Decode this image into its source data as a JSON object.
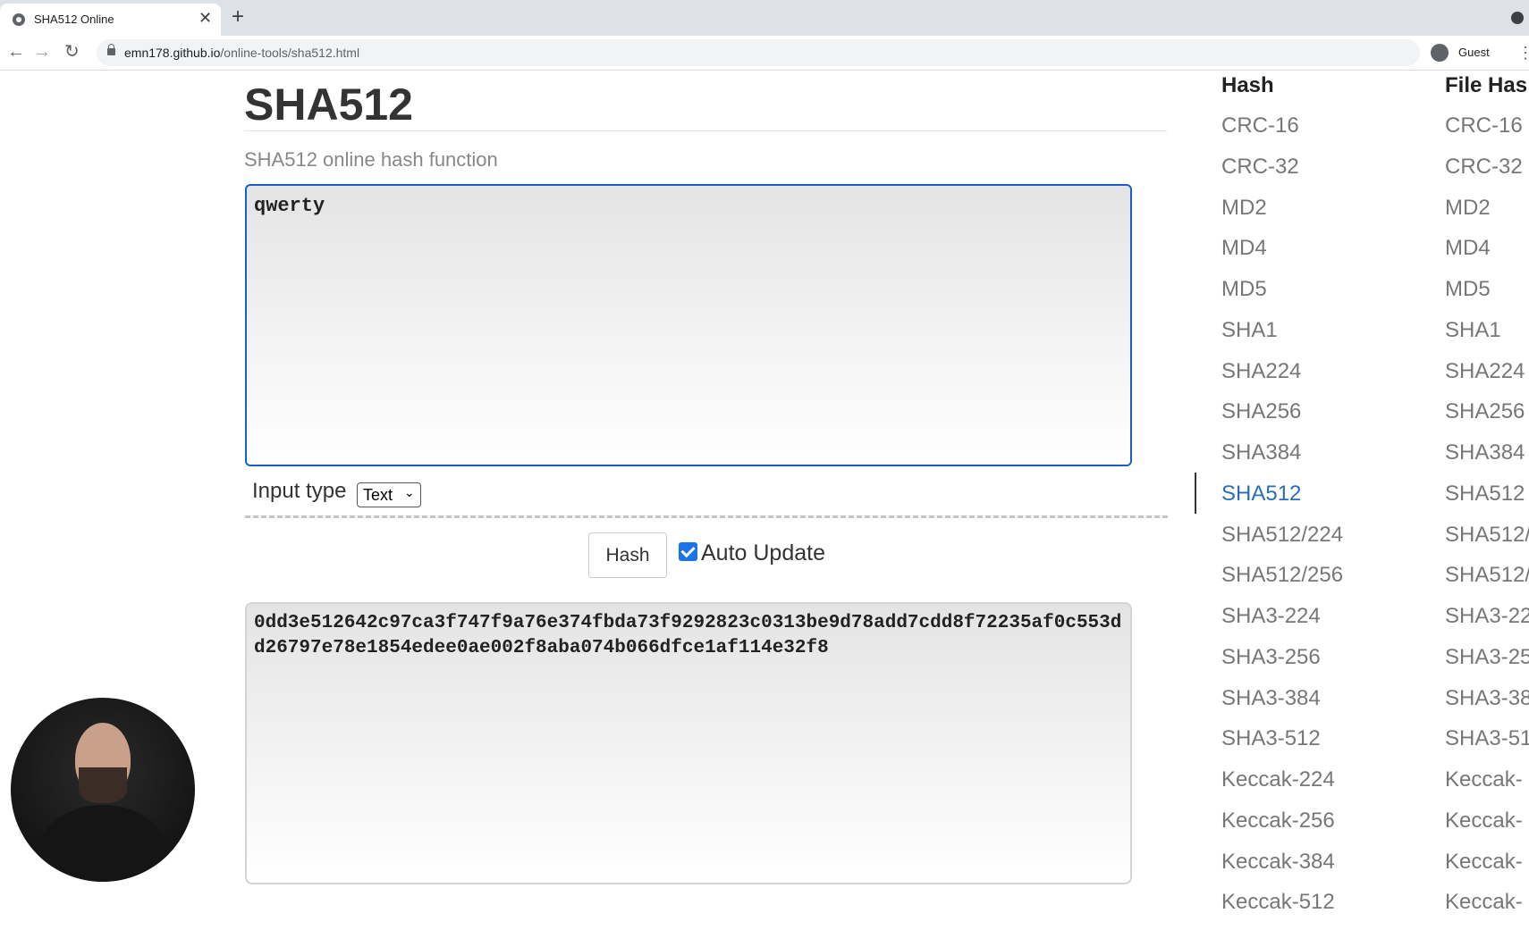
{
  "browser": {
    "tab_title": "SHA512 Online",
    "tab_close": "✕",
    "new_tab": "+",
    "back": "←",
    "forward": "→",
    "reload": "↻",
    "url_domain": "emn178.github.io",
    "url_path": "/online-tools/sha512.html",
    "profile_label": "Guest",
    "menu": "⋮"
  },
  "page": {
    "title": "SHA512",
    "subtitle": "SHA512 online hash function",
    "input_value": "qwerty",
    "input_type_label": "Input type",
    "input_type_selected": "Text",
    "hash_button": "Hash",
    "auto_update_label": "Auto Update",
    "auto_update_checked": true,
    "output_value": "0dd3e512642c97ca3f747f9a76e374fbda73f9292823c0313be9d78add7cdd8f72235af0c553dd26797e78e1854edee0ae002f8aba074b066dfce1af114e32f8"
  },
  "sidebar": {
    "hash_heading": "Hash",
    "file_hash_heading": "File Has",
    "hash_items": [
      "CRC-16",
      "CRC-32",
      "MD2",
      "MD4",
      "MD5",
      "SHA1",
      "SHA224",
      "SHA256",
      "SHA384",
      "SHA512",
      "SHA512/224",
      "SHA512/256",
      "SHA3-224",
      "SHA3-256",
      "SHA3-384",
      "SHA3-512",
      "Keccak-224",
      "Keccak-256",
      "Keccak-384",
      "Keccak-512"
    ],
    "file_hash_items": [
      "CRC-16",
      "CRC-32",
      "MD2",
      "MD4",
      "MD5",
      "SHA1",
      "SHA224",
      "SHA256",
      "SHA384",
      "SHA512",
      "SHA512/",
      "SHA512/",
      "SHA3-22",
      "SHA3-25",
      "SHA3-38",
      "SHA3-51",
      "Keccak-",
      "Keccak-",
      "Keccak-",
      "Keccak-"
    ],
    "active_item": "SHA512"
  }
}
